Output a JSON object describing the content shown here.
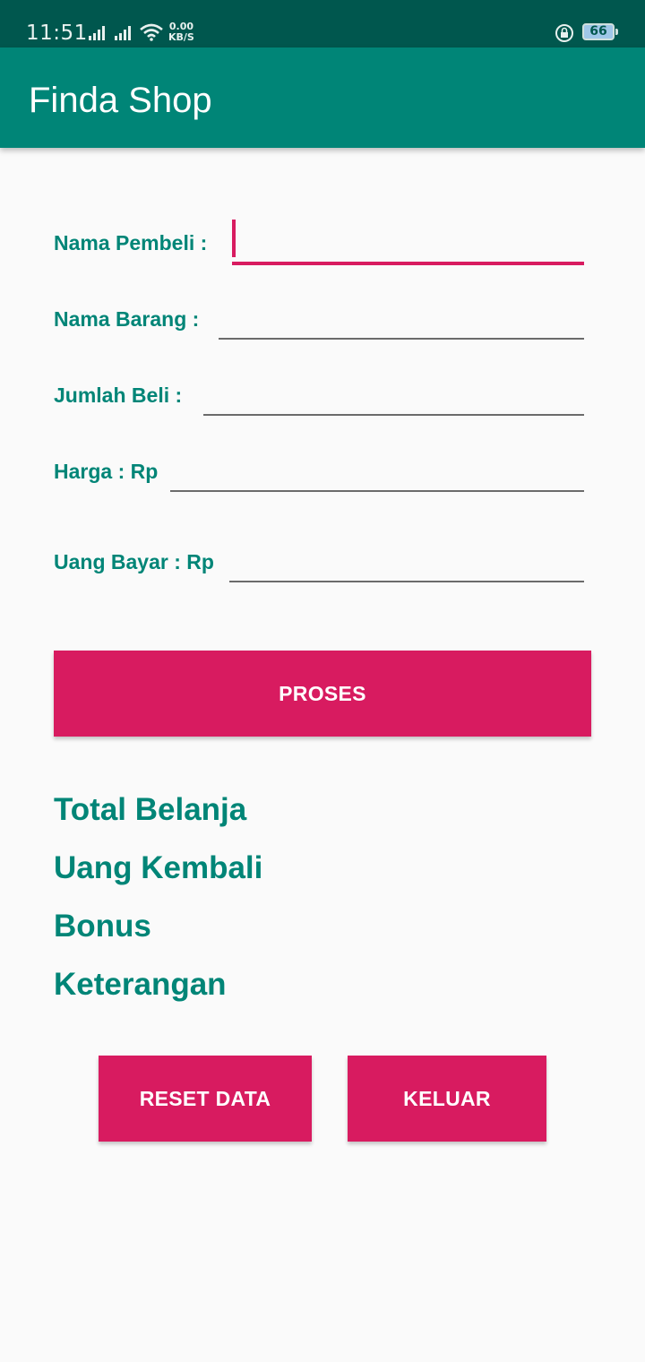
{
  "status_bar": {
    "time": "11:51",
    "net_speed_value": "0.00",
    "net_speed_unit": "KB/S",
    "battery": "66",
    "icons": [
      "signal-icon",
      "signal-icon",
      "wifi-icon",
      "rotation-lock-icon",
      "battery-icon"
    ]
  },
  "app_bar": {
    "title": "Finda Shop"
  },
  "form": {
    "fields": [
      {
        "label": "Nama Pembeli :",
        "value": "",
        "focused": true
      },
      {
        "label": "Nama Barang :",
        "value": ""
      },
      {
        "label": "Jumlah Beli :",
        "value": ""
      },
      {
        "label": "Harga : Rp",
        "value": ""
      },
      {
        "label": "Uang Bayar : Rp",
        "value": ""
      }
    ]
  },
  "buttons": {
    "proses": "PROSES",
    "reset": "RESET DATA",
    "keluar": "KELUAR"
  },
  "results": {
    "total_belanja": "Total Belanja",
    "uang_kembali": "Uang Kembali",
    "bonus": "Bonus",
    "keterangan": "Keterangan"
  },
  "colors": {
    "primary": "#008577",
    "primary_dark": "#00574e",
    "accent": "#d81b60",
    "background": "#fafafa"
  }
}
